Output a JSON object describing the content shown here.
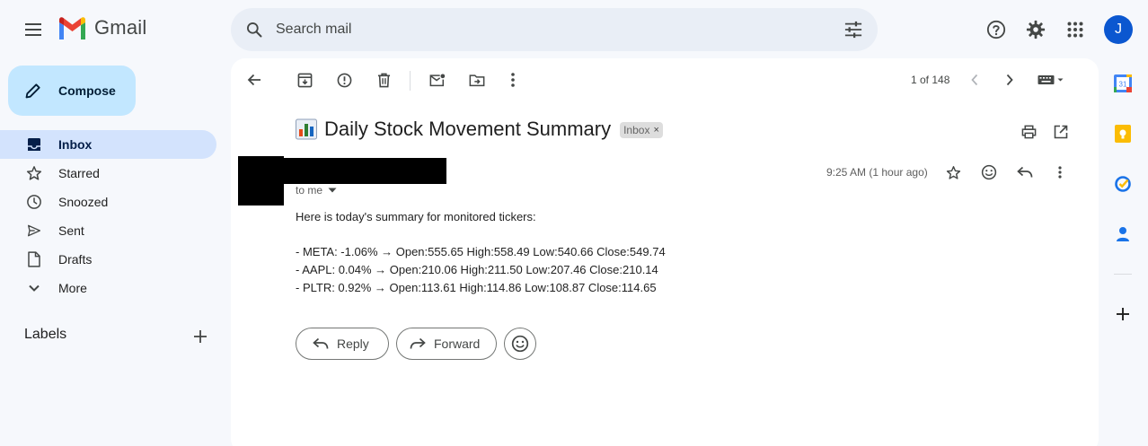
{
  "app": {
    "name": "Gmail"
  },
  "search": {
    "placeholder": "Search mail"
  },
  "account": {
    "initial": "J"
  },
  "sidebar": {
    "compose_label": "Compose",
    "items": [
      {
        "label": "Inbox",
        "icon": "inbox-icon",
        "active": true
      },
      {
        "label": "Starred",
        "icon": "star-icon"
      },
      {
        "label": "Snoozed",
        "icon": "clock-icon"
      },
      {
        "label": "Sent",
        "icon": "send-icon"
      },
      {
        "label": "Drafts",
        "icon": "draft-icon"
      },
      {
        "label": "More",
        "icon": "chevron-down-icon"
      }
    ],
    "labels_title": "Labels"
  },
  "toolbar": {
    "pager": "1 of 148"
  },
  "email": {
    "subject_emoji": "bar-chart-icon",
    "subject": "Daily Stock Movement Summary",
    "label_chip": "Inbox",
    "label_chip_close": "×",
    "recipient": "to me",
    "time": "9:25 AM (1 hour ago)",
    "body": {
      "intro": "Here is today's summary for monitored tickers:",
      "lines": [
        "- META: -1.06% → Open:555.65 High:558.49 Low:540.66 Close:549.74",
        "- AAPL: 0.04% → Open:210.06 High:211.50 Low:207.46 Close:210.14",
        "- PLTR: 0.92% → Open:113.61 High:114.86 Low:108.87 Close:114.65"
      ]
    },
    "actions": {
      "reply": "Reply",
      "forward": "Forward"
    }
  },
  "right_rail": {
    "calendar_day": "31"
  },
  "colors": {
    "background": "#f6f8fc",
    "compose_bg": "#c2e7ff",
    "active_nav": "#d3e3fd",
    "avatar": "#0b57d0"
  }
}
